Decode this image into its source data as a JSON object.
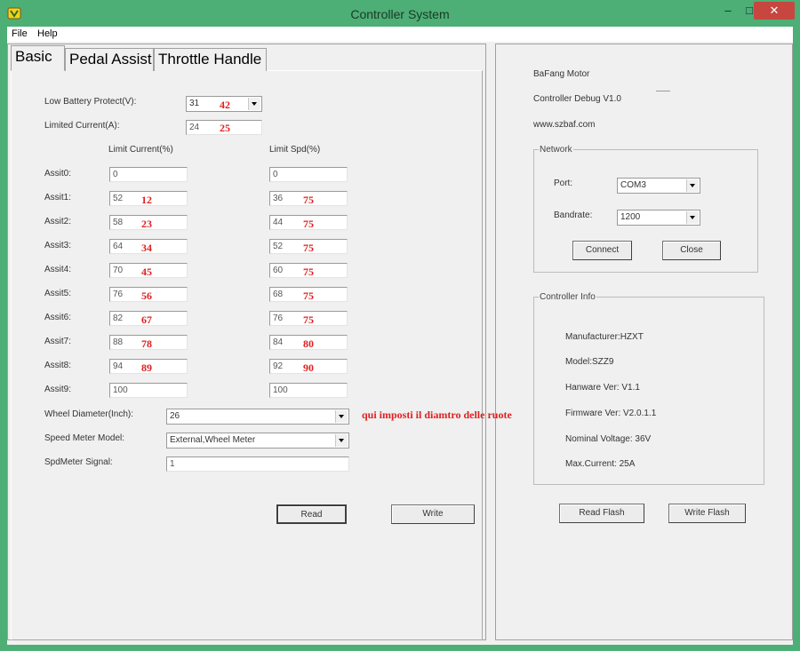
{
  "window": {
    "title": "Controller System",
    "minimize": "–",
    "maximize": "□",
    "close": "✕"
  },
  "menu": {
    "file": "File",
    "help": "Help"
  },
  "tabs": [
    "Basic",
    "Pedal Assist",
    "Throttle Handle"
  ],
  "basic": {
    "low_battery": {
      "label": "Low Battery Protect(V):",
      "value": "31",
      "note": "42"
    },
    "limited_current": {
      "label": "Limited Current(A):",
      "value": "24",
      "note": "25"
    },
    "col_current": "Limit Current(%)",
    "col_speed": "Limit Spd(%)",
    "assists": [
      {
        "label": "Assit0:",
        "current": "0",
        "speed": "0",
        "current_note": "",
        "speed_note": ""
      },
      {
        "label": "Assit1:",
        "current": "52",
        "speed": "36",
        "current_note": "12",
        "speed_note": "75"
      },
      {
        "label": "Assit2:",
        "current": "58",
        "speed": "44",
        "current_note": "23",
        "speed_note": "75"
      },
      {
        "label": "Assit3:",
        "current": "64",
        "speed": "52",
        "current_note": "34",
        "speed_note": "75"
      },
      {
        "label": "Assit4:",
        "current": "70",
        "speed": "60",
        "current_note": "45",
        "speed_note": "75"
      },
      {
        "label": "Assit5:",
        "current": "76",
        "speed": "68",
        "current_note": "56",
        "speed_note": "75"
      },
      {
        "label": "Assit6:",
        "current": "82",
        "speed": "76",
        "current_note": "67",
        "speed_note": "75"
      },
      {
        "label": "Assit7:",
        "current": "88",
        "speed": "84",
        "current_note": "78",
        "speed_note": "80"
      },
      {
        "label": "Assit8:",
        "current": "94",
        "speed": "92",
        "current_note": "89",
        "speed_note": "90"
      },
      {
        "label": "Assit9:",
        "current": "100",
        "speed": "100",
        "current_note": "",
        "speed_note": ""
      }
    ],
    "wheel": {
      "label": "Wheel Diameter(Inch):",
      "value": "26"
    },
    "wheel_note": "qui imposti il diamtro delle ruote",
    "speed_meter": {
      "label": "Speed Meter Model:",
      "value": "External,Wheel Meter"
    },
    "spd_signal": {
      "label": "SpdMeter Signal:",
      "value": "1"
    },
    "read_button": "Read",
    "write_button": "Write"
  },
  "info": {
    "brand": "BaFang Motor",
    "debug": "Controller Debug V1.0",
    "website": "www.szbaf.com",
    "network": {
      "title": "Network",
      "port_label": "Port:",
      "port_value": "COM3",
      "baud_label": "Bandrate:",
      "baud_value": "1200",
      "connect": "Connect",
      "close": "Close"
    },
    "controller": {
      "title": "Controller Info",
      "manufacturer": "Manufacturer:HZXT",
      "model": "Model:SZZ9",
      "hardware": "Hanware Ver: V1.1",
      "firmware": "Firmware Ver: V2.0.1.1",
      "voltage": "Nominal Voltage: 36V",
      "current": "Max.Current: 25A"
    },
    "read_flash": "Read Flash",
    "write_flash": "Write Flash"
  }
}
